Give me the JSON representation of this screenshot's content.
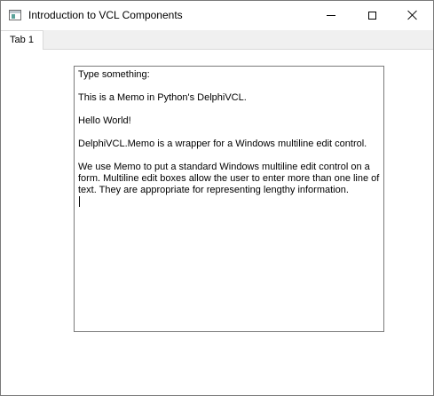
{
  "window": {
    "title": "Introduction to VCL Components",
    "icon": "app-window-icon"
  },
  "caption_buttons": {
    "minimize": "minimize-icon",
    "maximize": "maximize-icon",
    "close": "close-icon"
  },
  "tabs": [
    {
      "label": "Tab 1",
      "selected": true
    }
  ],
  "memo": {
    "lines": [
      "Type something:",
      "",
      "This is a Memo in Python's DelphiVCL.",
      "",
      "Hello World!",
      "",
      "DelphiVCL.Memo is a wrapper for a Windows multiline edit control.",
      "",
      "We use Memo to put a standard Windows multiline edit control on a",
      "form. Multiline edit boxes allow the user to enter more than one line of",
      "text. They are appropriate for representing lengthy information."
    ]
  }
}
